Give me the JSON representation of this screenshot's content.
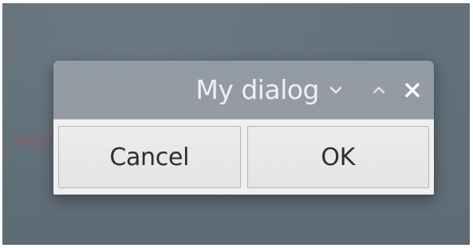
{
  "dialog": {
    "title": "My dialog",
    "titlebar_icons": [
      "chevron-down-icon",
      "chevron-up-icon",
      "close-icon"
    ],
    "buttons": {
      "cancel_label": "Cancel",
      "ok_label": "OK"
    }
  },
  "colors": {
    "desktop_background": "#626f78",
    "titlebar": "#949ba4",
    "title_text": "#eef0f2",
    "dialog_body": "#f0f0f0",
    "button_text": "#2e2e2e"
  }
}
